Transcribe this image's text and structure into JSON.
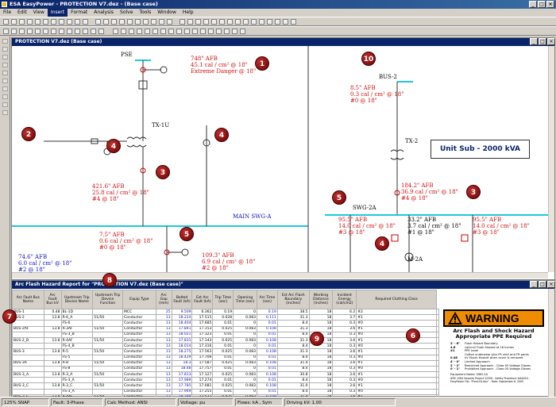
{
  "app": {
    "title": "ESA EasyPower - PROTECTION V7.dez - (Base case)"
  },
  "menu": [
    "File",
    "Edit",
    "View",
    "Insert",
    "Format",
    "Analysis",
    "Solve",
    "Tools",
    "Window",
    "Help"
  ],
  "oneline": {
    "title": "PROTECTION V7.dez  (Base case)",
    "labels": {
      "pse": "PSE",
      "tx1u": "TX-1U",
      "swga": "MAIN SWG-A",
      "bus2": "BUS-2",
      "tx2": "TX-2",
      "swg2a": "SWG-2A",
      "m2a": "M-2A",
      "unitsub": "Unit Sub - 2000 kVA",
      "fw": "F/W",
      "m": "M",
      "b10": "B10",
      "mt": "MT"
    },
    "afb": [
      {
        "l1": "748\" AFB",
        "l2": "45.1 cal / cm² @ 18\"",
        "l3": "Extreme Danger @ 18\""
      },
      {
        "l1": "421.6\" AFB",
        "l2": "25.8 cal / cm² @ 18\"",
        "l3": "#4 @ 18\""
      },
      {
        "l1": "7.5\" AFB",
        "l2": "0.6 cal / cm² @ 18\"",
        "l3": "#0 @ 18\""
      },
      {
        "l1": "109.3\" AFB",
        "l2": "6.9 cal / cm² @ 18\"",
        "l3": "#2 @ 18\""
      },
      {
        "l1": "74.6\" AFB",
        "l2": "6.0 cal / cm² @ 18\"",
        "l3": "#2 @ 18\""
      },
      {
        "l1": "8.5\" AFB",
        "l2": "0.3 cal / cm² @ 18\"",
        "l3": "#0 @ 18\""
      },
      {
        "l1": "184.2\" AFB",
        "l2": "36.9 cal / cm² @ 18\"",
        "l3": "#4 @ 18\""
      },
      {
        "l1": "95.5\" AFB",
        "l2": "14.0 cal / cm² @ 18\"",
        "l3": "#3 @ 18\""
      },
      {
        "l1": "33.2\" AFB",
        "l2": "3.7 cal / cm² @ 18\"",
        "l3": "#1 @ 18\""
      },
      {
        "l1": "95.5\" AFB",
        "l2": "14.0 cal / cm² @ 18\"",
        "l3": "#3 @ 18\""
      }
    ],
    "badges": [
      "1",
      "2",
      "3",
      "4",
      "5",
      "10",
      "5",
      "3",
      "4",
      "4"
    ]
  },
  "report": {
    "title": "Arc Flash Hazard Report for \"PROTECTION V7.dez (Base case)\"",
    "headers": [
      "Arc Fault Bus Name",
      "Arc Fault Bus kV",
      "Upstream Trip Device Name",
      "Upstream Trip Device Function",
      "Equip Type",
      "Arc Gap (mm)",
      "Bolted Fault (kA)",
      "Est Arc Fault (kA)",
      "Trip Time (sec)",
      "Opening Time (sec)",
      "Arc Time (sec)",
      "Est Arc Flash Boundary (inches)",
      "Working Distance (inches)",
      "Incident Energy (cal/cm2)",
      "Required Clothing Class"
    ],
    "rows": [
      [
        "BUS-1",
        "0.48",
        "BL-1D",
        "",
        "MCC",
        "25",
        "9.509",
        "6.362",
        "0.19",
        "0",
        "0.19",
        "38.5",
        "18",
        "6.2",
        "#2"
      ],
      [
        "BUS-2",
        "13.8",
        "R-6_A",
        "51/50",
        "Conductor",
        "13",
        "18.224",
        "17.515",
        "0.028",
        "0.083",
        "0.111",
        "31.3",
        "18",
        "3.7",
        "#1"
      ],
      [
        "",
        "",
        "FS-6",
        "",
        "Conductor",
        "13",
        "18.404",
        "17.685",
        "0.01",
        "0",
        "0.01",
        "8.4",
        "18",
        "0.3",
        "#0"
      ],
      [
        "BUS-2AF",
        "13.8",
        "R-3AF",
        "51/50",
        "Conductor",
        "13",
        "17.841",
        "17.153",
        "0.025",
        "0.083",
        "0.108",
        "31.3",
        "18",
        "3.6",
        "#1"
      ],
      [
        "",
        "",
        "FS-3_B",
        "",
        "Conductor",
        "13",
        "18.021",
        "17.323",
        "0.01",
        "0",
        "0.01",
        "8.4",
        "18",
        "0.3",
        "#0"
      ],
      [
        "BUS-2_B",
        "13.8",
        "R-4AF",
        "51/50",
        "Conductor",
        "13",
        "17.831",
        "17.143",
        "0.025",
        "0.083",
        "0.108",
        "31.3",
        "18",
        "3.6",
        "#1"
      ],
      [
        "",
        "",
        "FS-4_B",
        "",
        "Conductor",
        "13",
        "18.014",
        "17.316",
        "0.01",
        "0",
        "0.01",
        "8.4",
        "18",
        "0.3",
        "#0"
      ],
      [
        "BUS-3",
        "13.8",
        "R-5",
        "51/50",
        "Conductor",
        "13",
        "18.275",
        "17.563",
        "0.025",
        "0.083",
        "0.108",
        "31.3",
        "18",
        "3.6",
        "#1"
      ],
      [
        "",
        "",
        "FS-5",
        "",
        "Conductor",
        "13",
        "18.429",
        "17.709",
        "0.01",
        "0",
        "0.01",
        "8.4",
        "18",
        "0.3",
        "#0"
      ],
      [
        "BUS-3A",
        "13.8",
        "R-8",
        "51/50",
        "Conductor",
        "13",
        "18.3",
        "17.587",
        "0.025",
        "0.083",
        "0.108",
        "31.4",
        "18",
        "3.6",
        "#1"
      ],
      [
        "",
        "",
        "FS-8",
        "",
        "Conductor",
        "13",
        "18.48",
        "17.757",
        "0.01",
        "0",
        "0.01",
        "8.4",
        "18",
        "0.3",
        "#0"
      ],
      [
        "BUS-3_A",
        "13.8",
        "R-3_A",
        "51/50",
        "Conductor",
        "13",
        "17.813",
        "17.127",
        "0.025",
        "0.083",
        "0.108",
        "30.8",
        "18",
        "3.6",
        "#1"
      ],
      [
        "",
        "",
        "FS-3_A",
        "",
        "Conductor",
        "13",
        "17.989",
        "17.274",
        "0.01",
        "0",
        "0.01",
        "8.4",
        "18",
        "0.3",
        "#0"
      ],
      [
        "BUS-3_C",
        "13.8",
        "R-3_C",
        "51/50",
        "Conductor",
        "13",
        "17.785",
        "17.081",
        "0.025",
        "0.083",
        "0.108",
        "31.0",
        "18",
        "3.6",
        "#1"
      ],
      [
        "",
        "",
        "FS-3_A",
        "",
        "Conductor",
        "13",
        "17.949",
        "17.255",
        "0.01",
        "0",
        "0.01",
        "8.4",
        "18",
        "0.3",
        "#0"
      ],
      [
        "BUS-3_E",
        "13.8",
        "R-4AF",
        "51/50",
        "Conductor",
        "13",
        "18.289",
        "17.577",
        "0.025",
        "0.083",
        "0.108",
        "31.4",
        "18",
        "3.6",
        "#1"
      ],
      [
        "",
        "",
        "FS-3_C",
        "",
        "Conductor",
        "13",
        "18.478",
        "17.755",
        "0.01",
        "0",
        "0.01",
        "8.4",
        "18",
        "0.3",
        "#0"
      ]
    ],
    "badges": [
      "7",
      "8",
      "9",
      "6"
    ]
  },
  "label": {
    "warning": "WARNING",
    "sub1": "Arc Flash and Shock Hazard",
    "sub2": "Appropriate PPE Required",
    "lines": [
      [
        "2' - 6\"",
        "Flash Hazard Boundary"
      ],
      [
        "4.6",
        "cal/cm2 Flash Hazard at 18 Inches"
      ],
      [
        "#1",
        "PPE Level"
      ],
      [
        "",
        "Cotton underwear plus FR shirt and FR pants"
      ],
      [
        "0.48",
        "kV Shock Hazard when cover is removed"
      ],
      [
        "4' - 0\"",
        "Limited Approach"
      ],
      [
        "2' - 2\"",
        "Restricted Approach - Class 00 Voltage Gloves"
      ],
      [
        "0' - 1\"",
        "Prohibited Approach - Class 00 Voltage Gloves"
      ]
    ],
    "equip": "Equipment Name: SWG-2A",
    "foot1": "IEEE 1584 Hazards   Project 12356 - Safety Procedure #AA024 -",
    "foot2": "EasyPower File: \"Plant-04.dez\" - Date: September 6, 2005"
  },
  "status": [
    "125%  SNAP",
    "Fault: 3-Phase",
    "Calc Method: ANSI",
    "Voltage: pu",
    "Flows: kA , Sym",
    "Driving kV: 1.00"
  ]
}
